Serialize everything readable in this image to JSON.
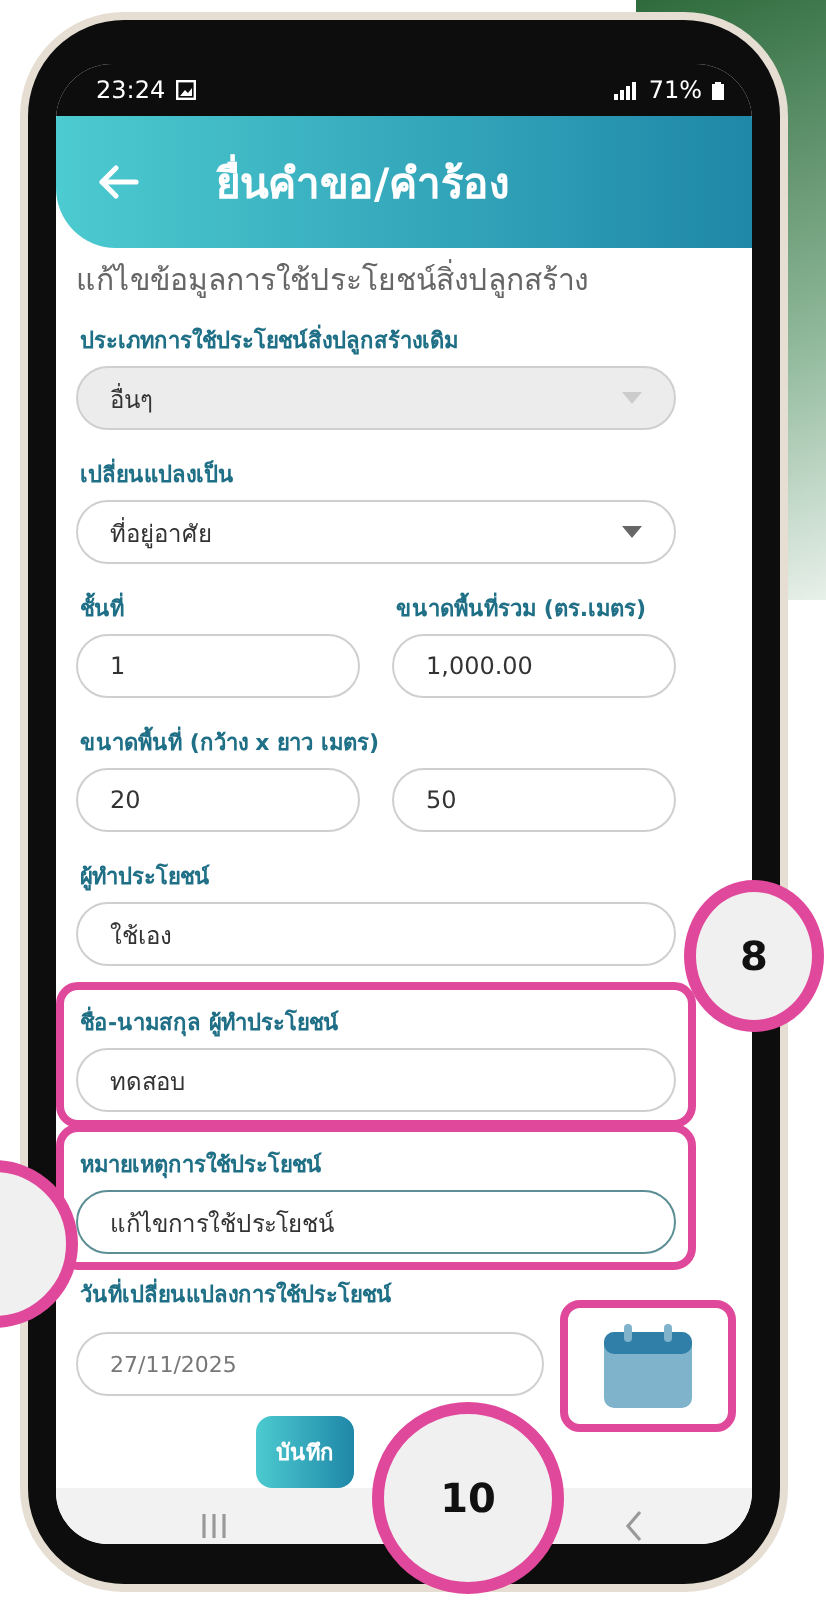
{
  "status_bar": {
    "time": "23:24",
    "battery": "71%"
  },
  "header": {
    "title": "ยื่นคำขอ/คำร้อง"
  },
  "section_title": "แก้ไขข้อมูลการใช้ประโยชน์สิ่งปลูกสร้าง",
  "fields": [
    {
      "kind": "select",
      "label": "ประเภทการใช้ประโยชน์สิ่งปลูกสร้างเดิม",
      "value": "อื่นๆ",
      "disabled": true
    },
    {
      "kind": "select",
      "label": "เปลี่ยนแปลงเป็น",
      "value": "ที่อยู่อาศัย",
      "disabled": false
    },
    {
      "kind": "split",
      "items": [
        {
          "label": "ชั้นที่",
          "value": "1"
        },
        {
          "label": "ขนาดพื้นที่รวม (ตร.เมตร)",
          "value": "1,000.00"
        }
      ]
    },
    {
      "kind": "pair",
      "label": "ขนาดพื้นที่ (กว้าง x ยาว เมตร)",
      "values": [
        "20",
        "50"
      ]
    },
    {
      "kind": "text",
      "label": "ผู้ทำประโยชน์",
      "value": "ใช้เอง",
      "highlighted": false,
      "focused": false
    },
    {
      "kind": "text",
      "label": "ชื่อ-นามสกุล ผู้ทำประโยชน์",
      "value": "ทดสอบ",
      "highlighted": true,
      "focused": false
    },
    {
      "kind": "text",
      "label": "หมายเหตุการใช้ประโยชน์",
      "value": "แก้ไขการใช้ประโยชน์",
      "highlighted": true,
      "focused": true
    },
    {
      "kind": "date",
      "label": "วันที่เปลี่ยนแปลงการใช้ประโยชน์",
      "value": "27/11/2025",
      "highlighted": true
    }
  ],
  "save_button": "บันทึก",
  "callouts": [
    {
      "label": "8"
    },
    {
      "label": "10"
    }
  ]
}
